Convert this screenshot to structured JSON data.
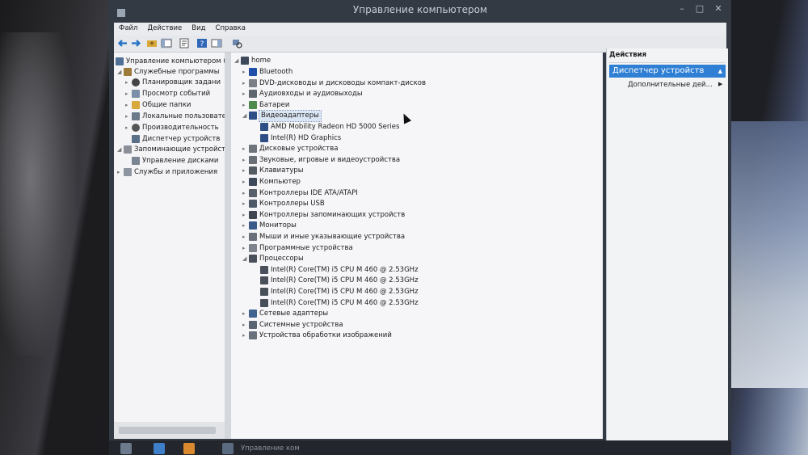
{
  "window": {
    "title": "Управление компьютером",
    "controls": {
      "minimize": "–",
      "maximize": "□",
      "close": "✕"
    }
  },
  "menu": [
    "Файл",
    "Действие",
    "Вид",
    "Справка"
  ],
  "left_tree": [
    {
      "label": "Управление компьютером (л",
      "icon": "computer-management-icon",
      "arrow": ""
    },
    {
      "label": "Служебные программы",
      "icon": "tools-icon",
      "arrow": "◢"
    },
    {
      "label": "Планировщик задани",
      "icon": "clock-icon",
      "arrow": "▸"
    },
    {
      "label": "Просмотр событий",
      "icon": "event-viewer-icon",
      "arrow": "▸"
    },
    {
      "label": "Общие папки",
      "icon": "shared-folder-icon",
      "arrow": "▸"
    },
    {
      "label": "Локальные пользовате",
      "icon": "users-icon",
      "arrow": "▸"
    },
    {
      "label": "Производительность",
      "icon": "performance-icon",
      "arrow": "▸"
    },
    {
      "label": "Диспетчер устройств",
      "icon": "device-manager-icon",
      "arrow": ""
    },
    {
      "label": "Запоминающие устройст",
      "icon": "storage-icon",
      "arrow": "◢"
    },
    {
      "label": "Управление дисками",
      "icon": "disk-icon",
      "arrow": ""
    },
    {
      "label": "Службы и приложения",
      "icon": "services-icon",
      "arrow": "▸"
    }
  ],
  "device_tree": {
    "root": "home",
    "items": [
      {
        "label": "Bluetooth",
        "icon": "bluetooth-icon",
        "arrow": "▸"
      },
      {
        "label": "DVD-дисководы и дисководы компакт-дисков",
        "icon": "dvd-icon",
        "arrow": "▸"
      },
      {
        "label": "Аудиовходы и аудиовыходы",
        "icon": "audio-icon",
        "arrow": "▸"
      },
      {
        "label": "Батареи",
        "icon": "battery-icon",
        "arrow": "▸"
      },
      {
        "label": "Видеоадаптеры",
        "icon": "display-adapter-icon",
        "arrow": "◢",
        "selected": true
      },
      {
        "label": "AMD Mobility Radeon HD 5000 Series",
        "icon": "display-adapter-icon",
        "arrow": "",
        "child": true
      },
      {
        "label": "Intel(R) HD Graphics",
        "icon": "display-adapter-icon",
        "arrow": "",
        "child": true
      },
      {
        "label": "Дисковые устройства",
        "icon": "disk-drive-icon",
        "arrow": "▸"
      },
      {
        "label": "Звуковые, игровые и видеоустройства",
        "icon": "sound-icon",
        "arrow": "▸"
      },
      {
        "label": "Клавиатуры",
        "icon": "keyboard-icon",
        "arrow": "▸"
      },
      {
        "label": "Компьютер",
        "icon": "computer-icon",
        "arrow": "▸"
      },
      {
        "label": "Контроллеры IDE ATA/ATAPI",
        "icon": "ide-controller-icon",
        "arrow": "▸"
      },
      {
        "label": "Контроллеры USB",
        "icon": "usb-icon",
        "arrow": "▸"
      },
      {
        "label": "Контроллеры запоминающих устройств",
        "icon": "storage-controller-icon",
        "arrow": "▸"
      },
      {
        "label": "Мониторы",
        "icon": "monitor-icon",
        "arrow": "▸"
      },
      {
        "label": "Мыши и иные указывающие устройства",
        "icon": "mouse-icon",
        "arrow": "▸"
      },
      {
        "label": "Программные устройства",
        "icon": "software-device-icon",
        "arrow": "▸"
      },
      {
        "label": "Процессоры",
        "icon": "processor-icon",
        "arrow": "◢"
      },
      {
        "label": "Intel(R) Core(TM) i5 CPU",
        "model": "M 460  @ 2.53GHz",
        "icon": "processor-icon",
        "arrow": "",
        "child": true
      },
      {
        "label": "Intel(R) Core(TM) i5 CPU",
        "model": "M 460  @ 2.53GHz",
        "icon": "processor-icon",
        "arrow": "",
        "child": true
      },
      {
        "label": "Intel(R) Core(TM) i5 CPU",
        "model": "M 460  @ 2.53GHz",
        "icon": "processor-icon",
        "arrow": "",
        "child": true
      },
      {
        "label": "Intel(R) Core(TM) i5 CPU",
        "model": "M 460  @ 2.53GHz",
        "icon": "processor-icon",
        "arrow": "",
        "child": true
      },
      {
        "label": "Сетевые адаптеры",
        "icon": "network-adapter-icon",
        "arrow": "▸"
      },
      {
        "label": "Системные устройства",
        "icon": "system-device-icon",
        "arrow": "▸"
      },
      {
        "label": "Устройства обработки изображений",
        "icon": "imaging-device-icon",
        "arrow": "▸"
      }
    ]
  },
  "actions": {
    "header": "Действия",
    "selected": "Диспетчер устройств",
    "selected_chevron": "▲",
    "more": "Дополнительные дей...",
    "more_chevron": "▶"
  },
  "taskbar": {
    "app_label": "Управление ком"
  },
  "colors": {
    "accent": "#2f7fd4",
    "window_chrome": "#343a44",
    "pane_bg": "#f6f6f8"
  }
}
